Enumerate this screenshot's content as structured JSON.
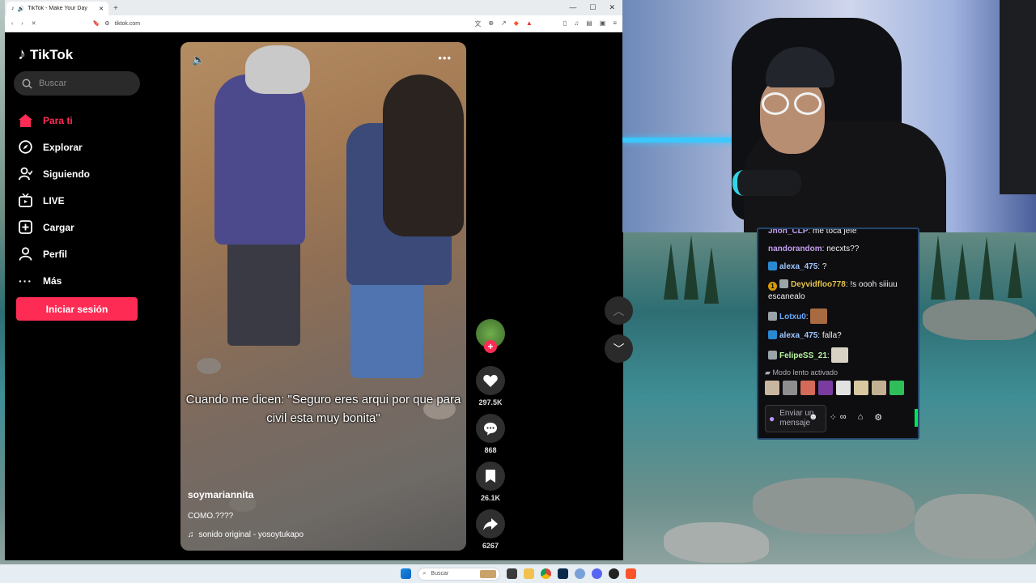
{
  "browser": {
    "tab_title": "TikTok - Make Your Day",
    "new_tab_glyph": "+",
    "url": "tiktok.com"
  },
  "tiktok": {
    "logo_text": "TikTok",
    "search_placeholder": "Buscar",
    "nav": [
      {
        "label": "Para ti",
        "icon": "home-icon",
        "active": true
      },
      {
        "label": "Explorar",
        "icon": "compass-icon"
      },
      {
        "label": "Siguiendo",
        "icon": "following-icon"
      },
      {
        "label": "LIVE",
        "icon": "live-icon"
      },
      {
        "label": "Cargar",
        "icon": "upload-icon"
      },
      {
        "label": "Perfil",
        "icon": "profile-icon"
      },
      {
        "label": "Más",
        "icon": "more-icon"
      }
    ],
    "login_label": "Iniciar sesión",
    "video": {
      "caption": "Cuando me dicen: \"Seguro eres arqui por que para civil esta muy bonita\"",
      "username": "soymariannita",
      "description": "COMO.????",
      "sound": "sonido original - yosoytukapo"
    },
    "actions": {
      "likes": "297.5K",
      "comments": "868",
      "saves": "26.1K",
      "shares": "6267"
    },
    "accent_color": "#fe2c55"
  },
  "chat": {
    "messages": [
      {
        "user": "Jhon_CLP",
        "color": "#c49fef",
        "text": ": me toca jefe"
      },
      {
        "user": "nandorandom",
        "color": "#c49fef",
        "text": ": necxts??"
      },
      {
        "user": "alexa_475",
        "color": "#9fc8ff",
        "text": ": ?",
        "badge": "#2a8ad1"
      },
      {
        "user": "Deyvidfloo778",
        "color": "#e6c44a",
        "text": ": !s oooh siiiuu escanealo",
        "badge": "#d99b00",
        "badge2": "#9aa3a8",
        "badge_text": "1"
      },
      {
        "user": "Lotxu0",
        "color": "#6aa9ff",
        "text": ":",
        "badge": "#9aa3a8",
        "emote": "#a86a40"
      },
      {
        "user": "alexa_475",
        "color": "#9fc8ff",
        "text": ": falla?",
        "badge": "#2a8ad1"
      },
      {
        "user": "FelipeSS_21",
        "color": "#b9f5a0",
        "text": ":",
        "badge": "#9aa3a8",
        "emote": "#d8d2c4"
      }
    ],
    "slow_mode": "Modo lento activado",
    "emote_colors": [
      "#c9b6a0",
      "#8e8e8e",
      "#d46a5a",
      "#7a3ca0",
      "#e2e2e2",
      "#d8c8a0",
      "#c2b090",
      "#2fbf5a"
    ],
    "input_placeholder": "Enviar un mensaje"
  },
  "taskbar": {
    "search_placeholder": "Buscar"
  }
}
